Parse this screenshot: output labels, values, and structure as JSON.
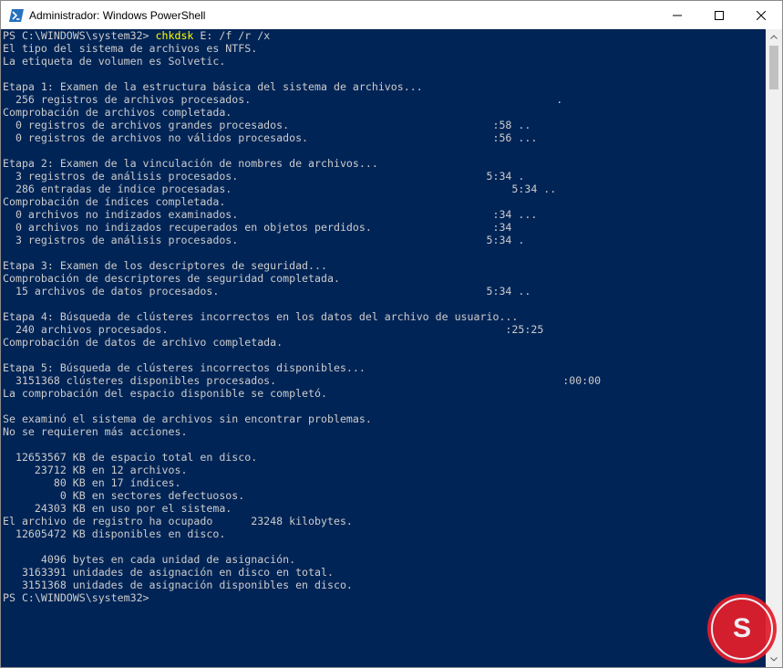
{
  "window": {
    "title": "Administrador: Windows PowerShell",
    "icon": "powershell-icon",
    "controls": {
      "minimize_icon": "minimize-icon",
      "maximize_icon": "maximize-icon",
      "close_icon": "close-icon"
    }
  },
  "colors": {
    "console_bg": "#012456",
    "console_text": "#cccccc",
    "command_highlight": "#ffff00",
    "titlebar_bg": "#ffffff",
    "watermark": "#e31e2c"
  },
  "console": {
    "prompt": {
      "path": "PS C:\\WINDOWS\\system32> ",
      "command": "chkdsk",
      "args": " E: /f /r /x"
    },
    "output": [
      "El tipo del sistema de archivos es NTFS.",
      "La etiqueta de volumen es Solvetic.",
      "",
      "Etapa 1: Examen de la estructura básica del sistema de archivos...",
      "  256 registros de archivos procesados.                                                .",
      "Comprobación de archivos completada.",
      "  0 registros de archivos grandes procesados.                                :58 ..",
      "  0 registros de archivos no válidos procesados.                             :56 ...",
      "",
      "Etapa 2: Examen de la vinculación de nombres de archivos...",
      "  3 registros de análisis procesados.                                       5:34 .",
      "  286 entradas de índice procesadas.                                            5:34 ..",
      "Comprobación de índices completada.",
      "  0 archivos no indizados examinados.                                        :34 ...",
      "  0 archivos no indizados recuperados en objetos perdidos.                   :34",
      "  3 registros de análisis procesados.                                       5:34 .",
      "",
      "Etapa 3: Examen de los descriptores de seguridad...",
      "Comprobación de descriptores de seguridad completada.",
      "  15 archivos de datos procesados.                                          5:34 ..",
      "",
      "Etapa 4: Búsqueda de clústeres incorrectos en los datos del archivo de usuario...",
      "  240 archivos procesados.                                                     :25:25",
      "Comprobación de datos de archivo completada.",
      "",
      "Etapa 5: Búsqueda de clústeres incorrectos disponibles...",
      "  3151368 clústeres disponibles procesados.                                             :00:00",
      "La comprobación del espacio disponible se completó.",
      "",
      "Se examinó el sistema de archivos sin encontrar problemas.",
      "No se requieren más acciones.",
      "",
      "  12653567 KB de espacio total en disco.",
      "     23712 KB en 12 archivos.",
      "        80 KB en 17 índices.",
      "         0 KB en sectores defectuosos.",
      "     24303 KB en uso por el sistema.",
      "El archivo de registro ha ocupado      23248 kilobytes.",
      "  12605472 KB disponibles en disco.",
      "",
      "      4096 bytes en cada unidad de asignación.",
      "   3163391 unidades de asignación en disco en total.",
      "   3151368 unidades de asignación disponibles en disco.",
      "PS C:\\WINDOWS\\system32>"
    ]
  },
  "scrollbar": {
    "up_icon": "scroll-up-arrow-icon",
    "down_icon": "scroll-down-arrow-icon"
  },
  "watermark": {
    "letter": "S",
    "icon": "solvetic-logo-icon"
  }
}
